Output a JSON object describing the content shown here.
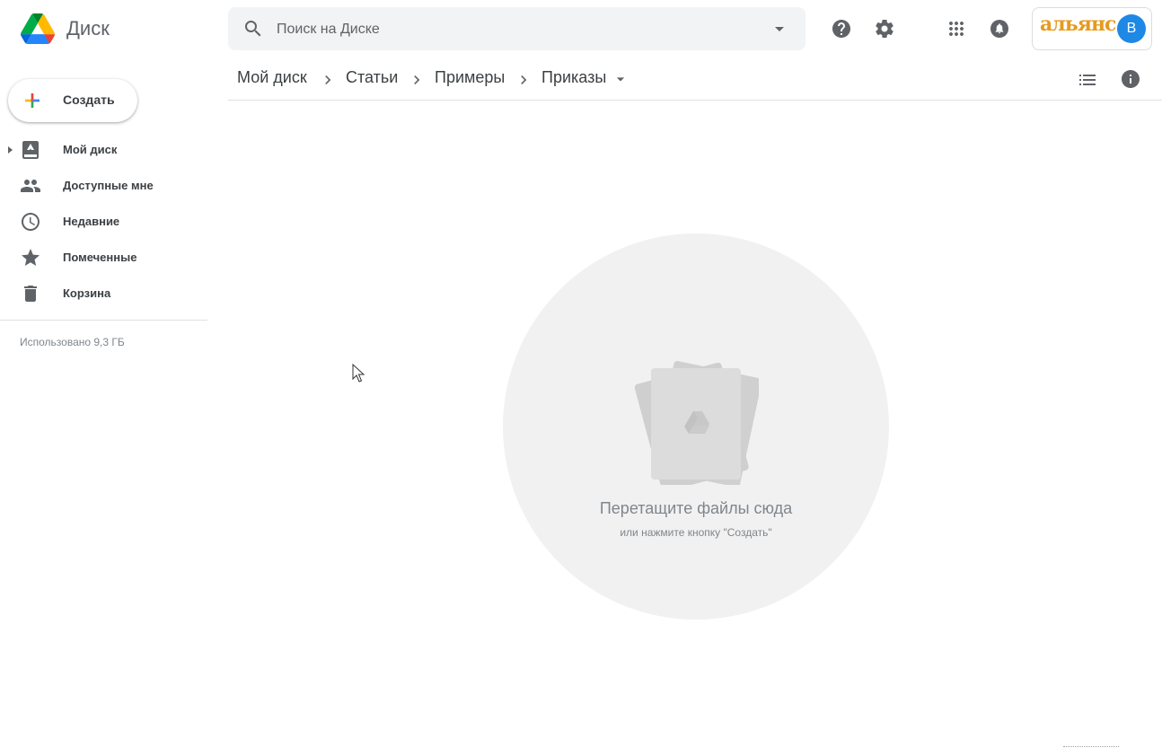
{
  "app": {
    "title": "Диск"
  },
  "search": {
    "placeholder": "Поиск на Диске"
  },
  "header": {
    "icons": [
      "help-icon",
      "settings-icon",
      "apps-icon",
      "notifications-icon"
    ],
    "account": {
      "brand_text": "альянс",
      "avatar_letter": "В"
    }
  },
  "breadcrumb": {
    "items": [
      "Мой диск",
      "Статьи",
      "Примеры",
      "Приказы"
    ],
    "view_icons": [
      "list-view-icon",
      "info-icon"
    ]
  },
  "sidebar": {
    "create_label": "Создать",
    "items": [
      {
        "label": "Мой диск",
        "icon": "drive-icon"
      },
      {
        "label": "Доступные мне",
        "icon": "people-icon"
      },
      {
        "label": "Недавние",
        "icon": "clock-icon"
      },
      {
        "label": "Помеченные",
        "icon": "star-icon"
      },
      {
        "label": "Корзина",
        "icon": "trash-icon"
      }
    ],
    "storage_text": "Использовано 9,3 ГБ"
  },
  "empty_state": {
    "title": "Перетащите файлы сюда",
    "subtitle": "или нажмите кнопку \"Создать\""
  },
  "colors": {
    "drive_green": "#0f9d58",
    "drive_yellow": "#f4b400",
    "drive_blue": "#4285f4",
    "avatar_blue": "#1e88e5",
    "brand_orange": "#e69a1d"
  }
}
